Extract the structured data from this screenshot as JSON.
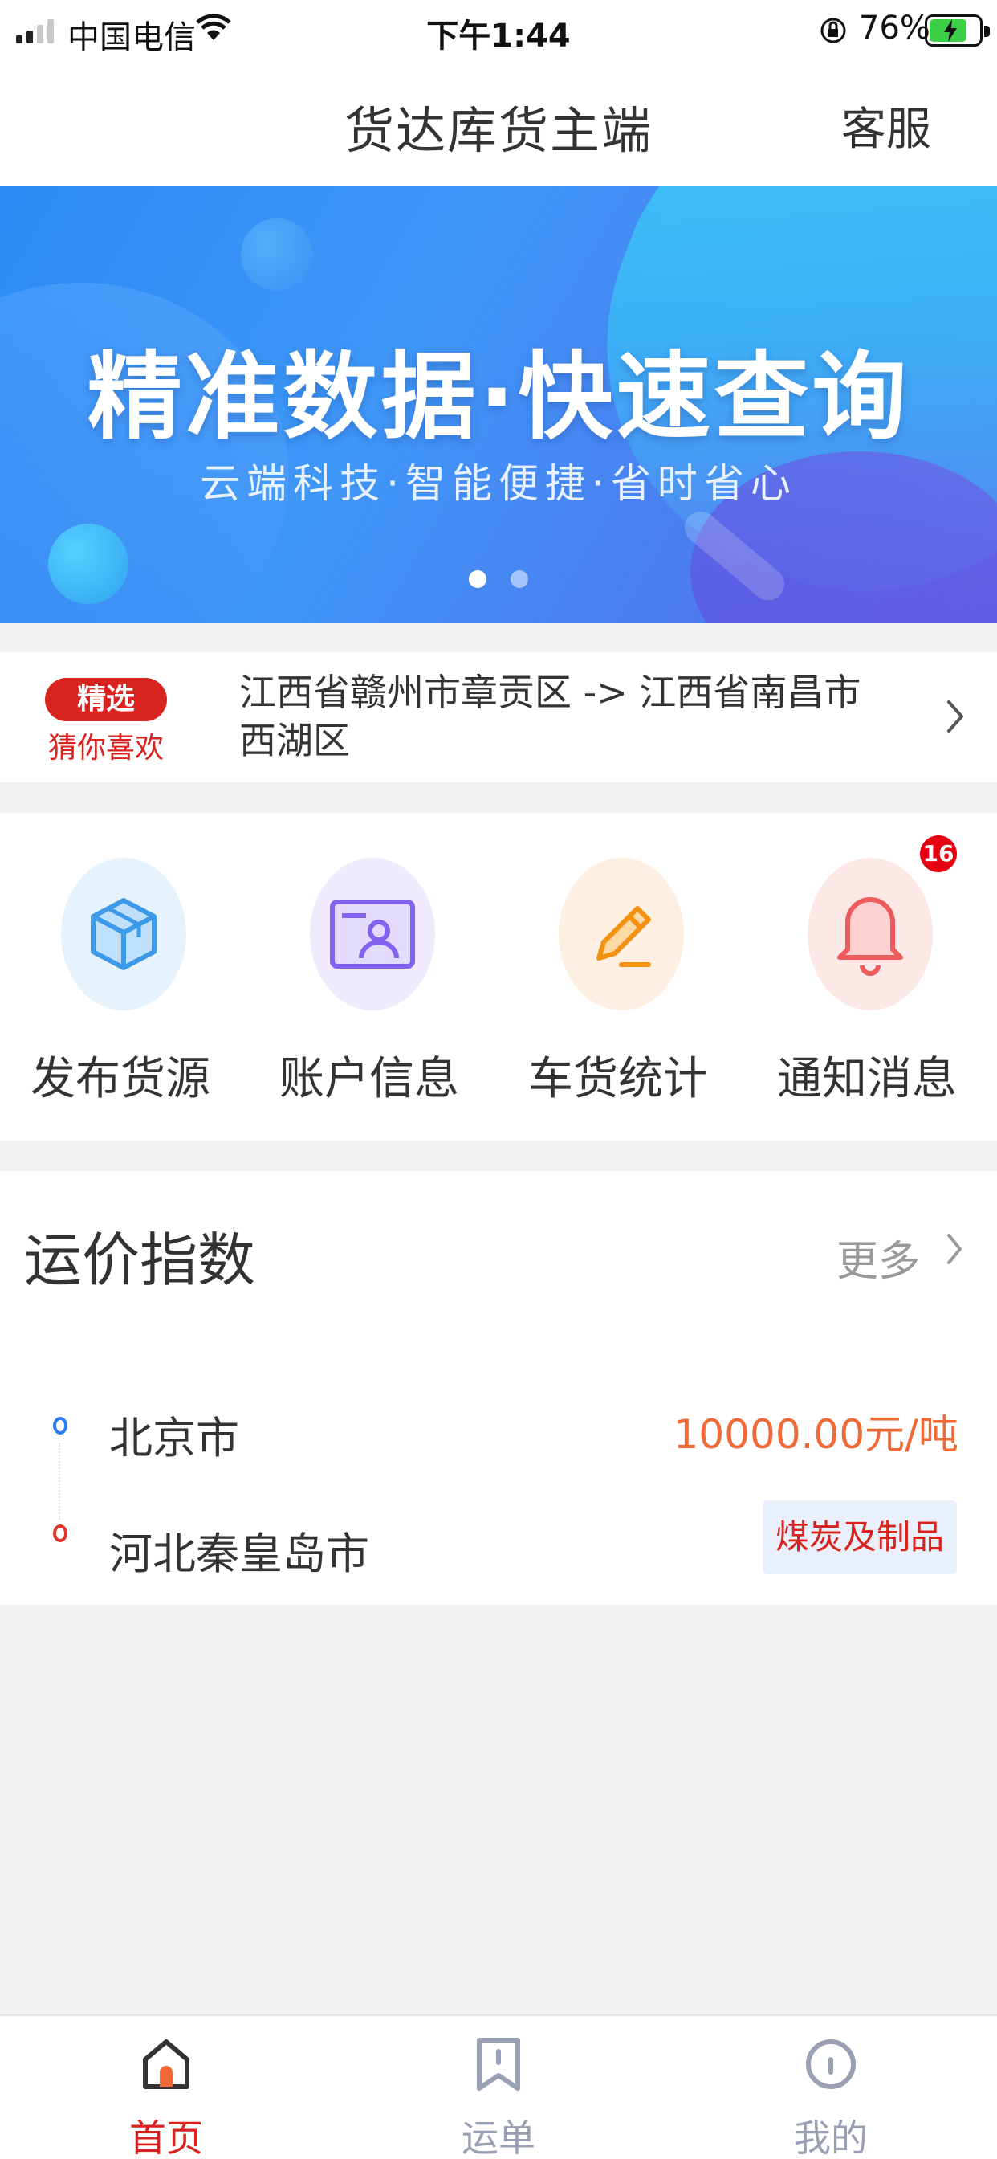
{
  "status_bar": {
    "carrier": "中国电信",
    "time": "下午1:44",
    "battery": "76%"
  },
  "nav": {
    "title": "货达库货主端",
    "service_label": "客服"
  },
  "banner": {
    "headline": "精准数据·快速查询",
    "subline": "云端科技·智能便捷·省时省心",
    "active_slide": 1,
    "slide_count": 2
  },
  "recommend": {
    "tag": "精选",
    "tag_sub": "猜你喜欢",
    "route": "江西省赣州市章贡区 -> 江西省南昌市西湖区"
  },
  "menu": {
    "items": [
      {
        "label": "发布货源",
        "icon": "package-icon",
        "color": "#4aa8f0"
      },
      {
        "label": "账户信息",
        "icon": "id-card-icon",
        "color": "#8a6cf0"
      },
      {
        "label": "车货统计",
        "icon": "pencil-icon",
        "color": "#f59a23"
      },
      {
        "label": "通知消息",
        "icon": "bell-icon",
        "color": "#f06a6a"
      }
    ],
    "notification_count": "16"
  },
  "freight_index": {
    "heading": "运价指数",
    "more": "更多",
    "from": "北京市",
    "to": "河北秦皇岛市",
    "price": "10000.00元/吨",
    "cargo": "煤炭及制品"
  },
  "tab_bar": {
    "tabs": [
      {
        "label": "首页",
        "icon": "home-icon",
        "active": true
      },
      {
        "label": "运单",
        "icon": "bookmark-icon",
        "active": false
      },
      {
        "label": "我的",
        "icon": "profile-icon",
        "active": false
      }
    ]
  },
  "colors": {
    "accent_red": "#d9231f",
    "price_orange": "#f06a38",
    "tab_inactive": "#9aa0b4"
  }
}
